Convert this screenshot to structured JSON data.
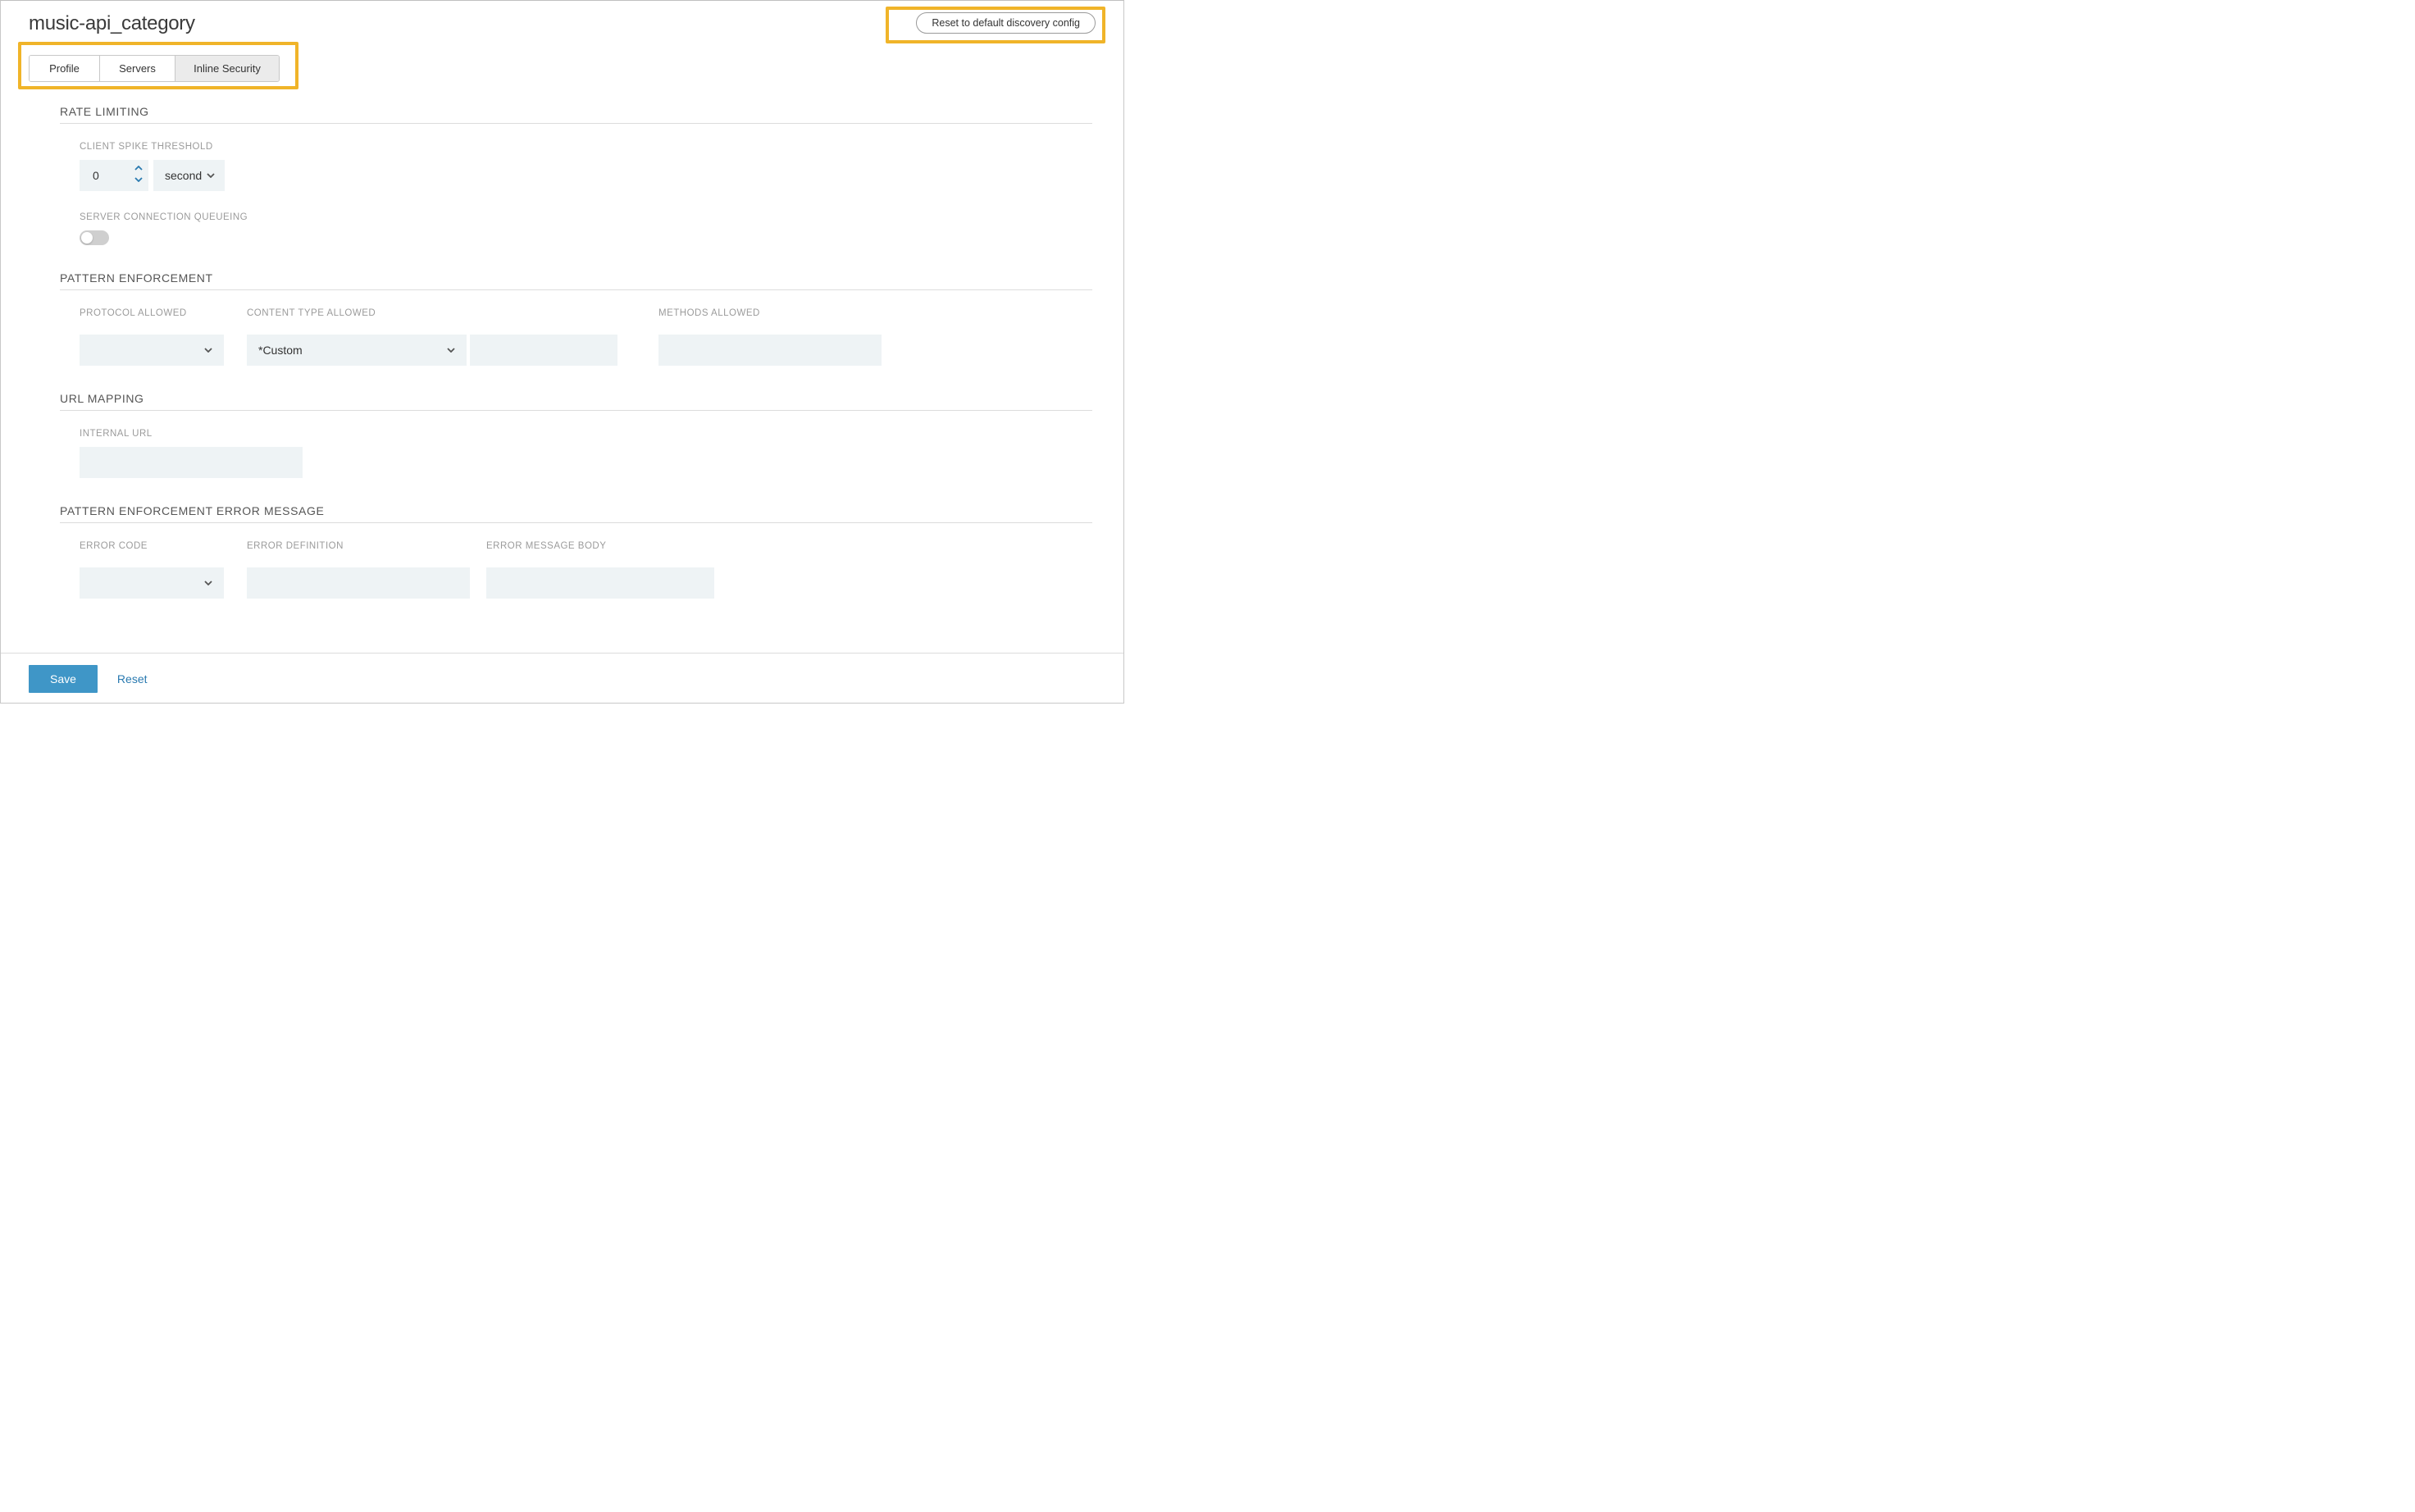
{
  "page_title": "music-api_category",
  "reset_discovery_label": "Reset to default discovery config",
  "tabs": {
    "profile": "Profile",
    "servers": "Servers",
    "inline_security": "Inline Security"
  },
  "rate_limiting": {
    "title": "RATE LIMITING",
    "client_spike_label": "CLIENT SPIKE THRESHOLD",
    "client_spike_value": "0",
    "client_spike_unit": "second",
    "server_queueing_label": "SERVER CONNECTION QUEUEING"
  },
  "pattern_enforcement": {
    "title": "PATTERN ENFORCEMENT",
    "protocol_label": "PROTOCOL ALLOWED",
    "protocol_value": "",
    "content_type_label": "CONTENT TYPE ALLOWED",
    "content_type_value": "*Custom",
    "content_type_extra": "",
    "methods_label": "METHODS ALLOWED",
    "methods_value": ""
  },
  "url_mapping": {
    "title": "URL MAPPING",
    "internal_url_label": "INTERNAL URL",
    "internal_url_value": ""
  },
  "error_message": {
    "title": "PATTERN ENFORCEMENT ERROR MESSAGE",
    "code_label": "ERROR CODE",
    "code_value": "",
    "definition_label": "ERROR DEFINITION",
    "definition_value": "",
    "body_label": "ERROR MESSAGE BODY",
    "body_value": ""
  },
  "footer": {
    "save": "Save",
    "reset": "Reset"
  }
}
